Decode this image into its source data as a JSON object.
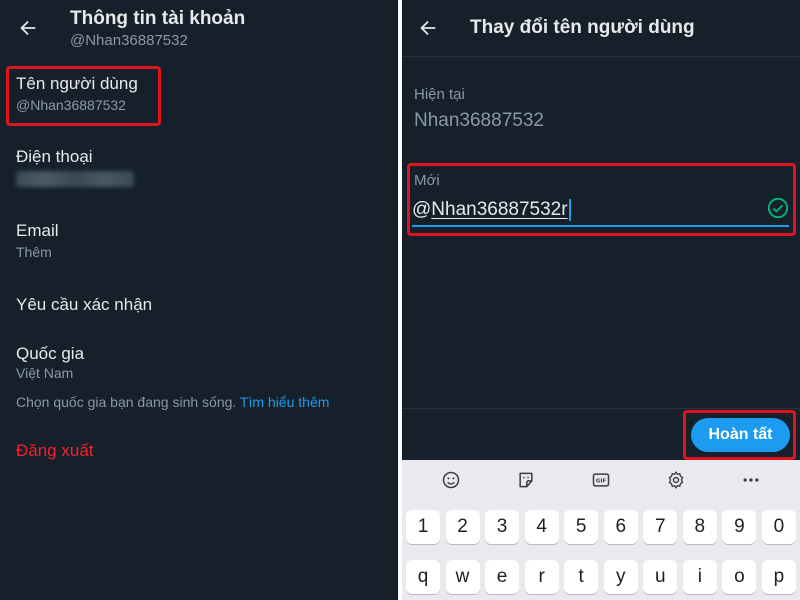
{
  "left": {
    "header": {
      "title": "Thông tin tài khoản",
      "handle": "@Nhan36887532"
    },
    "rows": {
      "username": {
        "title": "Tên người dùng",
        "value": "@Nhan36887532"
      },
      "phone": {
        "title": "Điện thoại"
      },
      "email": {
        "title": "Email",
        "value": "Thêm"
      },
      "verify": {
        "title": "Yêu cầu xác nhận"
      },
      "country": {
        "title": "Quốc gia",
        "value": "Việt Nam",
        "hint": "Chọn quốc gia bạn đang sinh sống.",
        "link": "Tìm hiểu thêm"
      },
      "logout": {
        "title": "Đăng xuất"
      }
    }
  },
  "right": {
    "header": {
      "title": "Thay đổi tên người dùng"
    },
    "current": {
      "label": "Hiện tại",
      "value": "Nhan36887532"
    },
    "new": {
      "label": "Mới",
      "prefix": "@",
      "value": "Nhan36887532r"
    },
    "done_button": "Hoàn tất",
    "keyboard": {
      "tools": [
        "emoji-icon",
        "sticker-icon",
        "gif-icon",
        "gear-icon",
        "more-icon"
      ],
      "gif_label": "GIF",
      "number_row": [
        "1",
        "2",
        "3",
        "4",
        "5",
        "6",
        "7",
        "8",
        "9",
        "0"
      ],
      "letter_row": [
        "q",
        "w",
        "e",
        "r",
        "t",
        "y",
        "u",
        "i",
        "o",
        "p"
      ]
    }
  },
  "colors": {
    "background": "#15202b",
    "accent": "#1d9bf0",
    "highlight": "#e0141e",
    "danger": "#f4212e"
  }
}
